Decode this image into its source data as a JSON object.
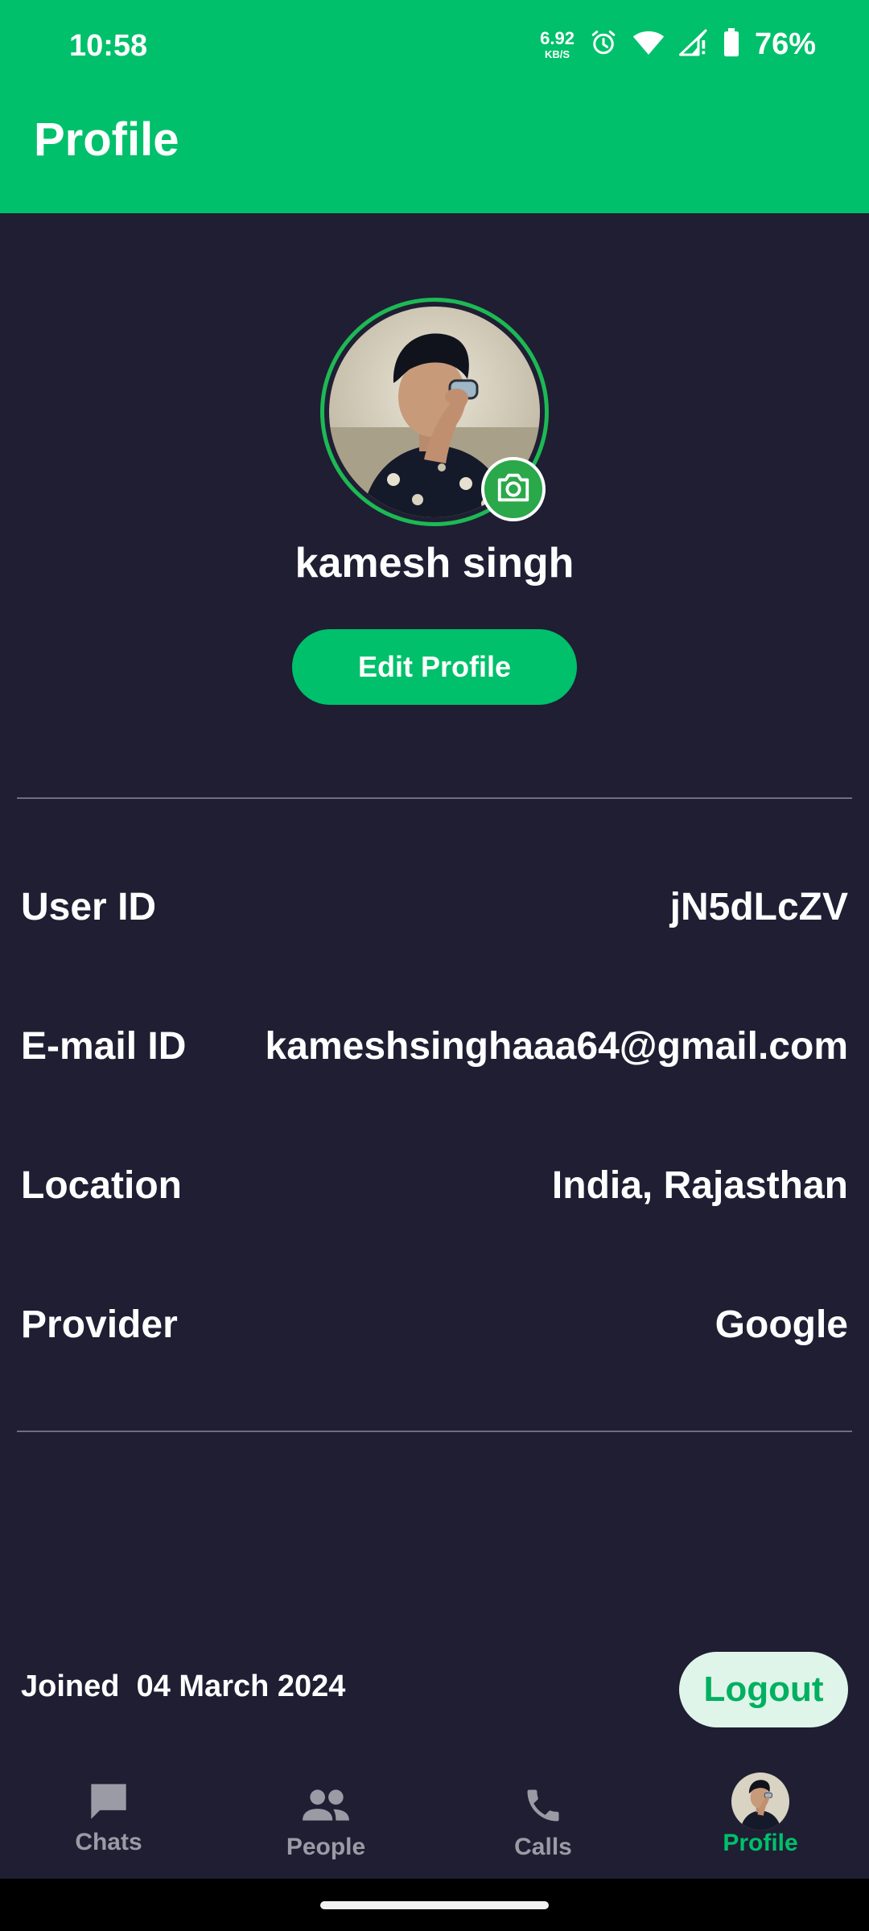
{
  "status_bar": {
    "time": "10:58",
    "net_speed_value": "6.92",
    "net_speed_unit": "KB/S",
    "battery_percent": "76%",
    "icons": [
      "alarm-icon",
      "wifi-icon",
      "signal-icon",
      "battery-icon"
    ]
  },
  "header": {
    "title": "Profile"
  },
  "profile": {
    "name": "kamesh singh",
    "edit_label": "Edit Profile",
    "avatar_icon": "camera-icon"
  },
  "details": [
    {
      "label": "User ID",
      "value": "jN5dLcZV"
    },
    {
      "label": "E-mail ID",
      "value": "kameshsinghaaa64@gmail.com"
    },
    {
      "label": "Location",
      "value": "India, Rajasthan"
    },
    {
      "label": "Provider",
      "value": "Google"
    }
  ],
  "footer": {
    "joined_text": "Joined  04 March 2024",
    "logout_label": "Logout"
  },
  "bottom_nav": {
    "items": [
      {
        "label": "Chats",
        "icon": "chat-icon"
      },
      {
        "label": "People",
        "icon": "people-icon"
      },
      {
        "label": "Calls",
        "icon": "phone-icon"
      },
      {
        "label": "Profile",
        "icon": "avatar"
      }
    ],
    "active": "Profile"
  },
  "colors": {
    "accent": "#00c06b",
    "background": "#1f1e33",
    "logout_bg": "#dff5e9",
    "inactive_nav": "#9b9ba6"
  }
}
